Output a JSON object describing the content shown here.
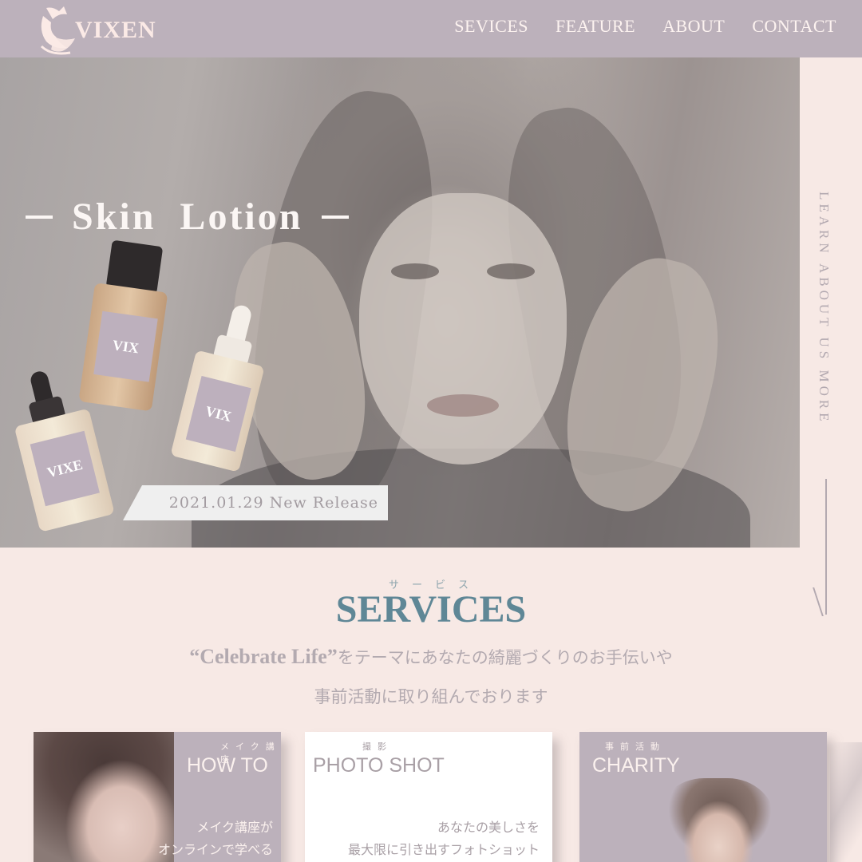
{
  "header": {
    "brand": "VIXEN",
    "nav": [
      "SEVICES",
      "FEATURE",
      "ABOUT",
      "CONTACT"
    ]
  },
  "hero": {
    "title": "Skin  Lotion",
    "release": "2021.01.29 New Release",
    "bottle_labels": [
      "VIX",
      "VIX",
      "VIXE"
    ]
  },
  "side_rail": {
    "text": "LEARN ABOUT US MORE"
  },
  "services": {
    "ruby": "サービス",
    "title": "SERVICES",
    "desc_quote": "“Celebrate Life”",
    "desc_line1": "をテーマにあなたの綺麗づくりのお手伝いや",
    "desc_line2": "事前活動に取り組んでおります",
    "cards": [
      {
        "kana": "メイク講座",
        "title": "HOW TO",
        "desc1": "メイク講座が",
        "desc2": "オンラインで学べる"
      },
      {
        "kana": "撮影",
        "title": "PHOTO SHOT",
        "desc1": "あなたの美しさを",
        "desc2": "最大限に引き出すフォトショット"
      },
      {
        "kana": "事前活動",
        "title": "CHARITY"
      }
    ]
  },
  "colors": {
    "header_bg": "#bcb1bb",
    "page_bg": "#f7e9e5",
    "accent": "#5f8796",
    "muted_text": "#b3aab0"
  }
}
